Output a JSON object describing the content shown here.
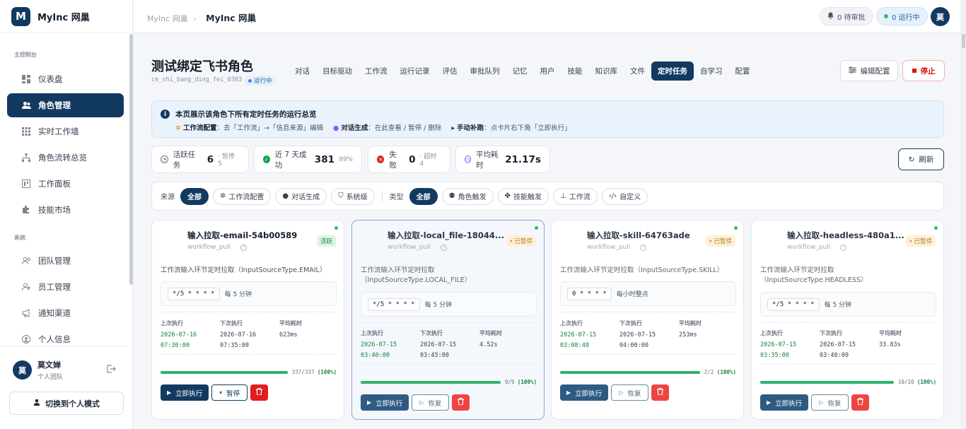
{
  "brand": {
    "logo": "M",
    "name": "MyInc 网巢"
  },
  "sidebar": {
    "section1": "主控制台",
    "section2": "系统",
    "items1": [
      {
        "label": "仪表盘",
        "icon": "dashboard-icon"
      },
      {
        "label": "角色管理",
        "icon": "users-icon"
      },
      {
        "label": "实时工作墙",
        "icon": "grid-icon"
      },
      {
        "label": "角色流转总览",
        "icon": "flow-icon"
      },
      {
        "label": "工作面板",
        "icon": "board-icon"
      },
      {
        "label": "技能市场",
        "icon": "puzzle-icon"
      }
    ],
    "items2": [
      {
        "label": "团队管理",
        "icon": "team-icon"
      },
      {
        "label": "员工管理",
        "icon": "staff-icon"
      },
      {
        "label": "通知渠道",
        "icon": "megaphone-icon"
      },
      {
        "label": "个人信息",
        "icon": "profile-icon"
      }
    ]
  },
  "user": {
    "avatar": "莫",
    "name": "莫文婵",
    "team": "个人团队",
    "switch_label": "切换到个人模式"
  },
  "topbar": {
    "crumb_parent": "MyInc 网巢",
    "crumb_current": "MyInc 网巢",
    "pending": "0 待审批",
    "running": "0 运行中",
    "avatar": "莫"
  },
  "role": {
    "title": "测试绑定飞书角色",
    "id": "ce_shi_bang_ding_fei_0303",
    "status": "运行中"
  },
  "tabs": [
    "对话",
    "目标驱动",
    "工作流",
    "运行记录",
    "评估",
    "审批队列",
    "记忆",
    "用户",
    "技能",
    "知识库",
    "文件",
    "定时任务",
    "自学习",
    "配置"
  ],
  "active_tab": "定时任务",
  "buttons": {
    "edit": "编辑配置",
    "stop": "停止",
    "refresh": "刷新"
  },
  "info": {
    "title": "本页展示该角色下所有定时任务的运行总览",
    "k1": "工作流配置",
    "v1": "去「工作流」→「信息来源」编辑",
    "k2": "对话生成",
    "v2": "在此查看 / 暂停 / 删除",
    "k3": "手动补跑",
    "v3": "点卡片右下角「立即执行」"
  },
  "stats": [
    {
      "label": "活跃任务",
      "value": "6",
      "sub": "· 暂停 5"
    },
    {
      "label": "近 7 天成功",
      "value": "381",
      "sub": "99%"
    },
    {
      "label": "失败",
      "value": "0",
      "sub": "· 超时 4"
    },
    {
      "label": "平均耗时",
      "value": "21.17s",
      "sub": ""
    }
  ],
  "filters": {
    "source_label": "来源",
    "source": [
      "全部",
      "工作流配置",
      "对话生成",
      "系统级"
    ],
    "type_label": "类型",
    "type": [
      "全部",
      "角色触发",
      "技能触发",
      "工作流",
      "自定义"
    ]
  },
  "labels": {
    "last": "上次执行",
    "next": "下次执行",
    "avg": "平均耗时",
    "run": "立即执行",
    "pause": "暂停",
    "resume": "恢复"
  },
  "cards": [
    {
      "title": "输入拉取-email-54b00589",
      "sub": "workflow_pull",
      "badge": "活跃",
      "desc": "工作流输入环节定时拉取（InputSourceType.EMAIL）",
      "cron": "*/5 * * * *",
      "cron_label": "每 5 分钟",
      "last1": "2026-07-16",
      "last2": "07:30:00",
      "next1": "2026-07-16",
      "next2": "07:35:00",
      "avg": "623ms",
      "prog": "337/337",
      "pct": "(100%)"
    },
    {
      "title": "输入拉取-local_file-18044...",
      "sub": "workflow_pull",
      "badge": "已暂停",
      "desc": "工作流输入环节定时拉取（InputSourceType.LOCAL_FILE）",
      "cron": "*/5 * * * *",
      "cron_label": "每 5 分钟",
      "last1": "2026-07-15",
      "last2": "03:40:00",
      "next1": "2026-07-15",
      "next2": "03:45:00",
      "avg": "4.52s",
      "prog": "9/9",
      "pct": "(100%)"
    },
    {
      "title": "输入拉取-skill-64763ade",
      "sub": "workflow_pull",
      "badge": "已暂停",
      "desc": "工作流输入环节定时拉取（InputSourceType.SKILL）",
      "cron": "0 * * * *",
      "cron_label": "每小时整点",
      "last1": "2026-07-15",
      "last2": "03:08:48",
      "next1": "2026-07-15",
      "next2": "04:00:00",
      "avg": "253ms",
      "prog": "2/2",
      "pct": "(100%)"
    },
    {
      "title": "输入拉取-headless-480a1...",
      "sub": "workflow_pull",
      "badge": "已暂停",
      "desc": "工作流输入环节定时拉取（InputSourceType.HEADLESS）",
      "cron": "*/5 * * * *",
      "cron_label": "每 5 分钟",
      "last1": "2026-07-15",
      "last2": "03:35:00",
      "next1": "2026-07-15",
      "next2": "03:40:00",
      "avg": "33.83s",
      "prog": "10/10",
      "pct": "(100%)"
    }
  ]
}
